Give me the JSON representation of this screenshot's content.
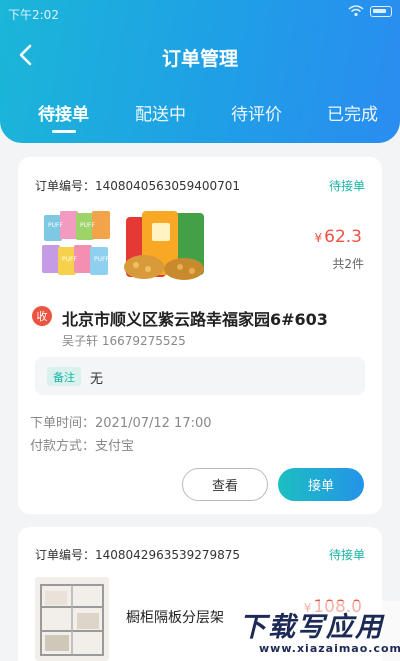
{
  "status_bar": {
    "time": "下午2:02"
  },
  "header": {
    "title": "订单管理"
  },
  "tabs": [
    {
      "label": "待接单",
      "active": true
    },
    {
      "label": "配送中",
      "active": false
    },
    {
      "label": "待评价",
      "active": false
    },
    {
      "label": "已完成",
      "active": false
    }
  ],
  "orders": [
    {
      "order_no": "订单编号：1408040563059400701",
      "status": "待接单",
      "currency": "¥",
      "price": "62.3",
      "count": "共2件",
      "address_badge": "收",
      "address": "北京市顺义区紫云路幸福家园6#603",
      "contact": "吴子轩 16679275525",
      "remark_label": "备注",
      "remark_value": "无",
      "order_time": "下单时间：2021/07/12 17:00",
      "payment": "付款方式：支付宝",
      "view_label": "查看",
      "accept_label": "接单"
    },
    {
      "order_no": "订单编号：1408042963539279875",
      "status": "待接单",
      "product_name": "橱柜隔板分层架",
      "currency": "¥",
      "price": "108.0"
    }
  ],
  "watermark": {
    "main": "下载写应用",
    "sub": "www.xiazaimao.com"
  },
  "colors": {
    "accent": "#1f9fe6",
    "price": "#ea5440",
    "status": "#19b4a6"
  }
}
